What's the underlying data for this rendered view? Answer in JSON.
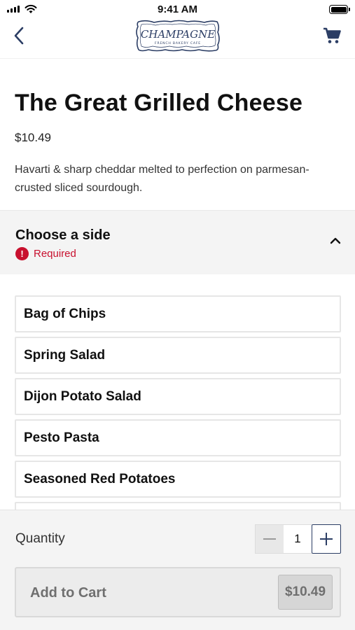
{
  "status_bar": {
    "time": "9:41 AM"
  },
  "nav": {
    "back_icon": "chevron-left-icon",
    "logo_text": "CHAMPAGNE",
    "logo_subtext": "FRENCH BAKERY CAFE",
    "cart_icon": "shopping-cart-icon"
  },
  "product": {
    "title": "The Great Grilled Cheese",
    "price": "$10.49",
    "description": "Havarti & sharp cheddar melted to perfection on parmesan-crusted sliced sourdough."
  },
  "side_section": {
    "title": "Choose a side",
    "required_label": "Required",
    "required_icon": "exclamation-circle-icon",
    "expanded": true,
    "options": [
      {
        "label": "Bag of Chips"
      },
      {
        "label": "Spring Salad"
      },
      {
        "label": "Dijon Potato Salad"
      },
      {
        "label": "Pesto Pasta"
      },
      {
        "label": "Seasoned Red Potatoes"
      }
    ]
  },
  "footer": {
    "quantity_label": "Quantity",
    "quantity_value": "1",
    "add_to_cart_label": "Add to Cart",
    "add_to_cart_price": "$10.49"
  },
  "colors": {
    "brand_navy": "#2b3d64",
    "required_red": "#c8102e",
    "panel_gray": "#f4f4f4"
  }
}
